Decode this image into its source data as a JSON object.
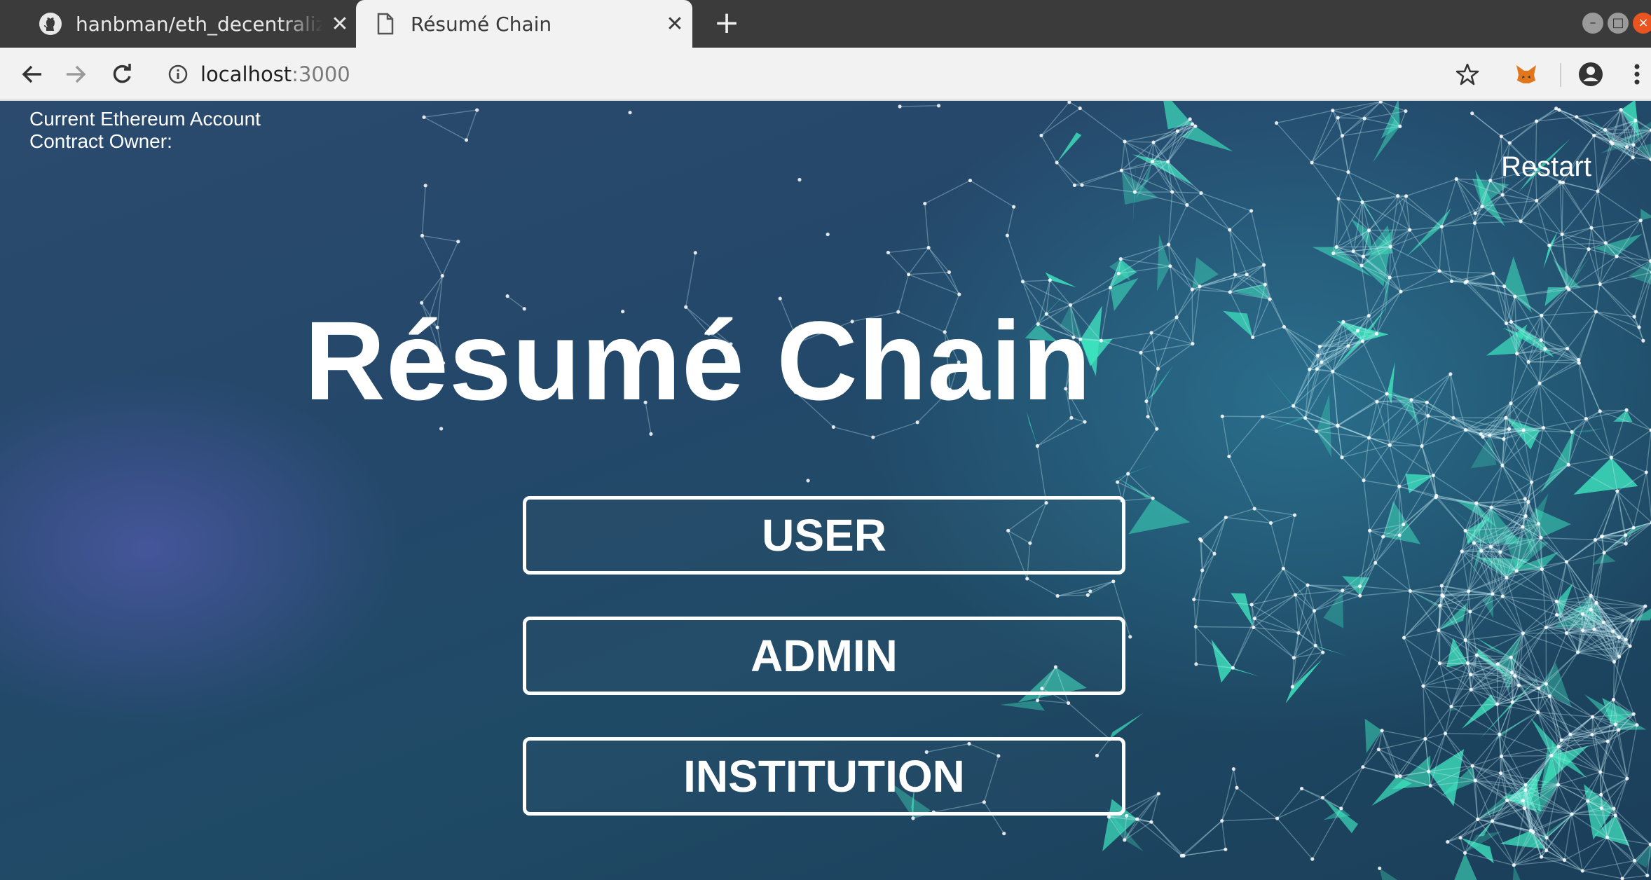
{
  "browser": {
    "tabs": [
      {
        "title": "hanbman/eth_decentraliz",
        "icon": "github-icon",
        "active": false
      },
      {
        "title": "Résumé Chain",
        "icon": "page-icon",
        "active": true
      }
    ],
    "new_tab": "+",
    "address": {
      "host": "localhost",
      "port": ":3000"
    }
  },
  "page": {
    "account_label": "Current Ethereum Account",
    "owner_label": "Contract Owner:",
    "restart_label": "Restart",
    "title": "Résumé Chain",
    "buttons": {
      "user": "USER",
      "admin": "ADMIN",
      "institution": "INSTITUTION"
    }
  },
  "colors": {
    "accent_teal": "#3fe6c0",
    "background_blue": "#24486a"
  }
}
